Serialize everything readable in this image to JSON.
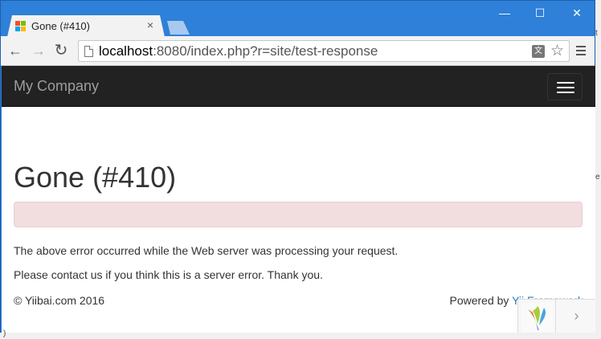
{
  "browser": {
    "tab_title": "Gone (#410)",
    "tab_close": "×",
    "window_controls": {
      "minimize": "—",
      "maximize": "☐",
      "close": "✕"
    },
    "nav": {
      "back": "←",
      "forward": "→",
      "reload": "↻"
    },
    "url_host": "localhost",
    "url_rest": ":8080/index.php?r=site/test-response",
    "translate_glyph": "文",
    "star_glyph": "☆"
  },
  "page": {
    "brand": "My Company",
    "error_title": "Gone (#410)",
    "alert_text": "",
    "message_1": "The above error occurred while the Web server was processing your request.",
    "message_2": "Please contact us if you think this is a server error. Thank you.",
    "footer_copyright": "© Yiibai.com 2016",
    "footer_powered_prefix": "Powered by ",
    "footer_powered_link": "Yii Framework"
  },
  "yii_debug": {
    "next_glyph": "›"
  },
  "edge_fragments": {
    "top": "t",
    "middle": "e",
    "bottom": ")"
  },
  "colors": {
    "navbar_bg": "#222222",
    "brand_text": "#9d9d9d",
    "alert_bg": "#f2dede",
    "link": "#337ab7",
    "titlebar": "#2e80d8"
  }
}
